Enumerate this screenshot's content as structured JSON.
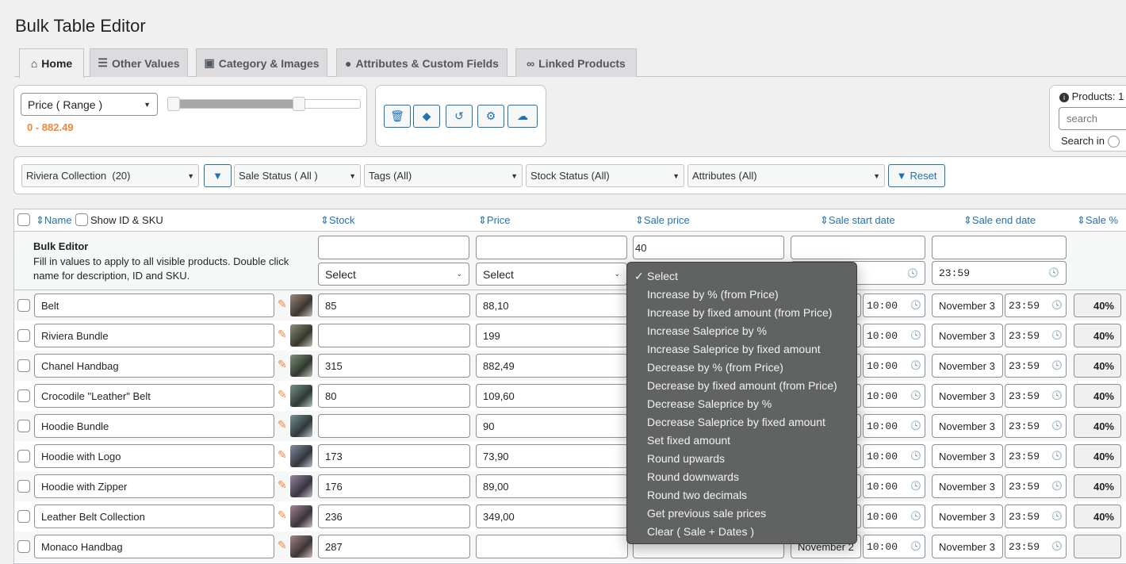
{
  "title": "Bulk Table Editor",
  "tabs": [
    {
      "label": "Home",
      "icon": "home-icon"
    },
    {
      "label": "Other Values",
      "icon": "list-icon"
    },
    {
      "label": "Category & Images",
      "icon": "image-icon"
    },
    {
      "label": "Attributes & Custom Fields",
      "icon": "tag-icon"
    },
    {
      "label": "Linked Products",
      "icon": "link-icon"
    }
  ],
  "range": {
    "select": "Price ( Range )",
    "value_text": "0 - 882.49",
    "min": 0,
    "max": 882.49,
    "low_fraction": 0,
    "high_fraction": 0.68
  },
  "toolbar": {
    "icons": [
      "trash-icon",
      "eraser-icon",
      "undo-icon",
      "gear-icon",
      "cloud-download-icon"
    ]
  },
  "products_panel": {
    "label": "Products: 1",
    "search_placeholder": "search",
    "search_in": "Search in"
  },
  "filters": {
    "category": "Riviera Collection  (20)",
    "sale_status": "Sale Status ( All )",
    "tags": "Tags (All)",
    "stock_status": "Stock Status (All)",
    "attributes": "Attributes (All)",
    "reset": "Reset"
  },
  "table": {
    "headers": {
      "name": "Name",
      "show_id": "Show ID & SKU",
      "stock": "Stock",
      "price": "Price",
      "sale_price": "Sale price",
      "sale_start": "Sale start date",
      "sale_end": "Sale end date",
      "sale_pct": "Sale %"
    },
    "bulk": {
      "title": "Bulk Editor",
      "desc1": "Fill in values to apply to all visible products. Double click",
      "desc2": "name for description, ID and SKU.",
      "stock_select": "Select",
      "price_select": "Select",
      "sale_price_value": "40",
      "end_time": "23:59"
    },
    "rows": [
      {
        "name": "Belt",
        "stock": "85",
        "price": "88,10",
        "start_time": "10:00",
        "end_date": "November 3",
        "end_time": "23:59",
        "pct": "40%"
      },
      {
        "name": "Riviera Bundle",
        "stock": "",
        "price": "199",
        "start_time": "10:00",
        "end_date": "November 3",
        "end_time": "23:59",
        "pct": "40%"
      },
      {
        "name": "Chanel Handbag",
        "stock": "315",
        "price": "882,49",
        "start_time": "10:00",
        "end_date": "November 3",
        "end_time": "23:59",
        "pct": "40%"
      },
      {
        "name": "Crocodile \"Leather\" Belt",
        "stock": "80",
        "price": "109,60",
        "start_time": "10:00",
        "end_date": "November 3",
        "end_time": "23:59",
        "pct": "40%"
      },
      {
        "name": "Hoodie Bundle",
        "stock": "",
        "price": "90",
        "start_time": "10:00",
        "end_date": "November 3",
        "end_time": "23:59",
        "pct": "40%"
      },
      {
        "name": "Hoodie with Logo",
        "stock": "173",
        "price": "73,90",
        "start_time": "10:00",
        "end_date": "November 3",
        "end_time": "23:59",
        "pct": "40%"
      },
      {
        "name": "Hoodie with Zipper",
        "stock": "176",
        "price": "89,00",
        "start_time": "10:00",
        "end_date": "November 3",
        "end_time": "23:59",
        "pct": "40%"
      },
      {
        "name": "Leather Belt Collection",
        "stock": "236",
        "price": "349,00",
        "start_time": "10:00",
        "end_date": "November 3",
        "end_time": "23:59",
        "pct": "40%"
      },
      {
        "name": "Monaco Handbag",
        "stock": "287",
        "price": "",
        "start_date": "November 2",
        "start_time": "10:00",
        "end_date": "November 3",
        "end_time": "23:59",
        "pct": ""
      }
    ]
  },
  "dropdown": {
    "selected": "Select",
    "options": [
      "Select",
      "Increase by % (from Price)",
      "Increase by fixed amount (from Price)",
      "Increase Saleprice by %",
      "Increase Saleprice by fixed amount",
      "Decrease by % (from Price)",
      "Decrease by fixed amount (from Price)",
      "Decrease Saleprice by %",
      "Decrease Saleprice by fixed amount",
      "Set fixed amount",
      "Round upwards",
      "Round downwards",
      "Round two decimals",
      "Get previous sale prices",
      "Clear ( Sale + Dates )"
    ]
  },
  "colors": {
    "accent": "#2271b1",
    "orange": "#f0883a"
  }
}
